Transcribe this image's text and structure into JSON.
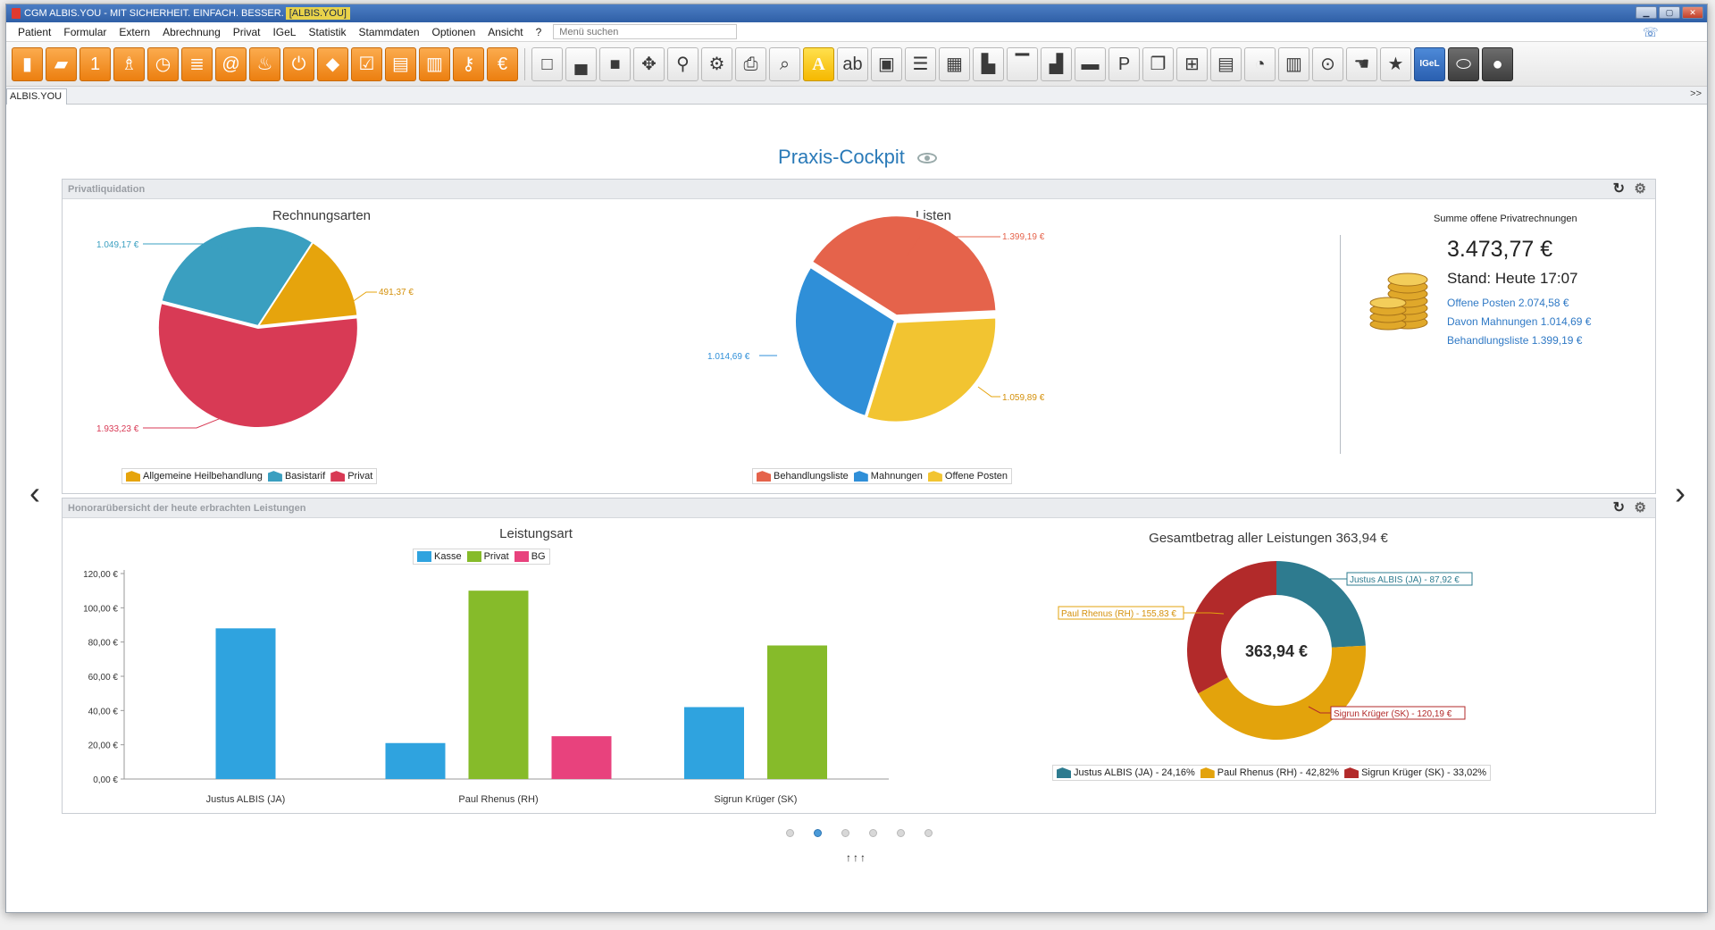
{
  "window": {
    "title_prefix": "CGM ALBIS.YOU - MIT SICHERHEIT. EINFACH. BESSER.",
    "title_suffix": "[ALBIS.YOU]"
  },
  "menu": {
    "items": [
      "Patient",
      "Formular",
      "Extern",
      "Abrechnung",
      "Privat",
      "IGeL",
      "Statistik",
      "Stammdaten",
      "Optionen",
      "Ansicht",
      "?"
    ],
    "search_placeholder": "Menü suchen"
  },
  "tabs": {
    "active": "ALBIS.YOU",
    "more": ">>"
  },
  "cockpit": {
    "title": "Praxis-Cockpit"
  },
  "panel_private": {
    "header": "Privatliquidation",
    "chart1": {
      "title": "Rechnungsarten",
      "labels": [
        "1.049,17 €",
        "491,37 €",
        "1.933,23 €"
      ],
      "legend": [
        "Allgemeine Heilbehandlung",
        "Basistarif",
        "Privat"
      ]
    },
    "chart2": {
      "title": "Listen",
      "labels": [
        "1.399,19 €",
        "1.014,69 €",
        "1.059,89 €"
      ],
      "legend": [
        "Behandlungsliste",
        "Mahnungen",
        "Offene Posten"
      ]
    },
    "summary": {
      "title": "Summe offene Privatrechnungen",
      "total": "3.473,77 €",
      "stand": "Stand: Heute 17:07",
      "offene_posten": "Offene Posten 2.074,58 €",
      "mahnungen": "Davon Mahnungen 1.014,69 €",
      "behandlungsliste": "Behandlungsliste 1.399,19 €"
    }
  },
  "panel_fees": {
    "header": "Honorarübersicht der heute erbrachten Leistungen",
    "bar_title": "Leistungsart",
    "bar_legend": [
      "Kasse",
      "Privat",
      "BG"
    ],
    "y_ticks": [
      "0,00 €",
      "20,00 €",
      "40,00 €",
      "60,00 €",
      "80,00 €",
      "100,00 €",
      "120,00 €"
    ],
    "donut_title": "Gesamtbetrag aller Leistungen 363,94 €",
    "donut_center": "363,94 €",
    "donut_labels": [
      "Justus ALBIS (JA) - 87,92 €",
      "Paul Rhenus (RH) - 155,83 €",
      "Sigrun Krüger (SK) - 120,19 €"
    ],
    "donut_legend": [
      "Justus ALBIS (JA) - 24,16%",
      "Paul Rhenus (RH) - 42,82%",
      "Sigrun Krüger (SK) - 33,02%"
    ]
  },
  "pager": {
    "up_arrows": "↑↑↑"
  },
  "chart_data": [
    {
      "type": "pie",
      "title": "Rechnungsarten",
      "categories": [
        "Allgemeine Heilbehandlung",
        "Basistarif",
        "Privat"
      ],
      "values": [
        491.37,
        1049.17,
        1933.23
      ],
      "colors": [
        "#e6a40c",
        "#3a9fc0",
        "#d83a55"
      ],
      "legend": "bottom"
    },
    {
      "type": "pie",
      "title": "Listen",
      "categories": [
        "Behandlungsliste",
        "Mahnungen",
        "Offene Posten"
      ],
      "values": [
        1399.19,
        1014.69,
        1059.89
      ],
      "colors": [
        "#e5634b",
        "#2f8fd8",
        "#f2c431"
      ],
      "legend": "bottom"
    },
    {
      "type": "bar",
      "title": "Leistungsart",
      "categories": [
        "Justus ALBIS (JA)",
        "Paul Rhenus (RH)",
        "Sigrun Krüger (SK)"
      ],
      "series": [
        {
          "name": "Kasse",
          "values": [
            88,
            21,
            42
          ],
          "color": "#2fa3df"
        },
        {
          "name": "Privat",
          "values": [
            0,
            110,
            78
          ],
          "color": "#86bb2a"
        },
        {
          "name": "BG",
          "values": [
            0,
            25,
            0
          ],
          "color": "#e8427d"
        }
      ],
      "ylim": [
        0,
        120
      ],
      "legend": "top"
    },
    {
      "type": "pie",
      "title": "Gesamtbetrag aller Leistungen 363,94 €",
      "categories": [
        "Justus ALBIS (JA)",
        "Paul Rhenus (RH)",
        "Sigrun Krüger (SK)"
      ],
      "values": [
        87.92,
        155.83,
        120.19
      ],
      "colors": [
        "#2e7b8f",
        "#e3a30c",
        "#b22a2a"
      ],
      "legend": "bottom"
    }
  ]
}
